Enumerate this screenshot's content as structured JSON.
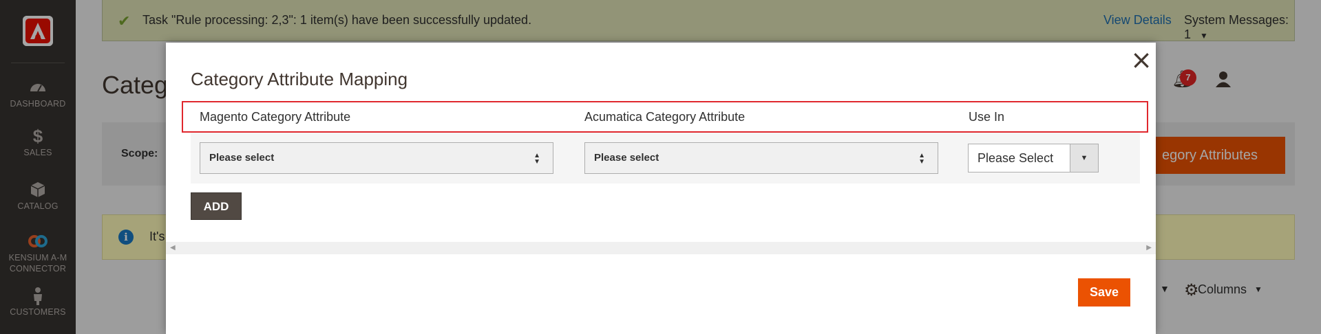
{
  "sidebar": {
    "items": [
      {
        "label": "DASHBOARD",
        "icon": "speedometer-icon"
      },
      {
        "label": "SALES",
        "icon": "dollar-icon"
      },
      {
        "label": "CATALOG",
        "icon": "box-icon"
      },
      {
        "label": "KENSIUM A-M CONNECTOR",
        "label_line1": "KENSIUM A-M",
        "label_line2": "CONNECTOR",
        "icon": "link-rings-icon"
      },
      {
        "label": "CUSTOMERS",
        "icon": "person-icon"
      }
    ]
  },
  "banner": {
    "message": "Task \"Rule processing: 2,3\": 1 item(s) have been successfully updated.",
    "view_details": "View Details",
    "system_messages": "System Messages: 1"
  },
  "header": {
    "page_title_partial": "Categ",
    "notification_count": "7"
  },
  "scope": {
    "label": "Scope:",
    "action_button_partial": "egory Attributes"
  },
  "info": {
    "text_partial": "It's"
  },
  "grid_controls": {
    "columns_label": "Columns"
  },
  "modal": {
    "title": "Category Attribute Mapping",
    "columns": [
      "Magento Category Attribute",
      "Acumatica Category Attribute",
      "Use In"
    ],
    "row": {
      "magento_select": "Please select",
      "acumatica_select": "Please select",
      "use_in_select": "Please Select"
    },
    "add_label": "ADD",
    "save_label": "Save",
    "close_symbol": "×"
  },
  "colors": {
    "accent": "#eb5202",
    "sidebar_bg": "#373330",
    "highlight_border": "#e0272d",
    "success": "#79a22e"
  }
}
